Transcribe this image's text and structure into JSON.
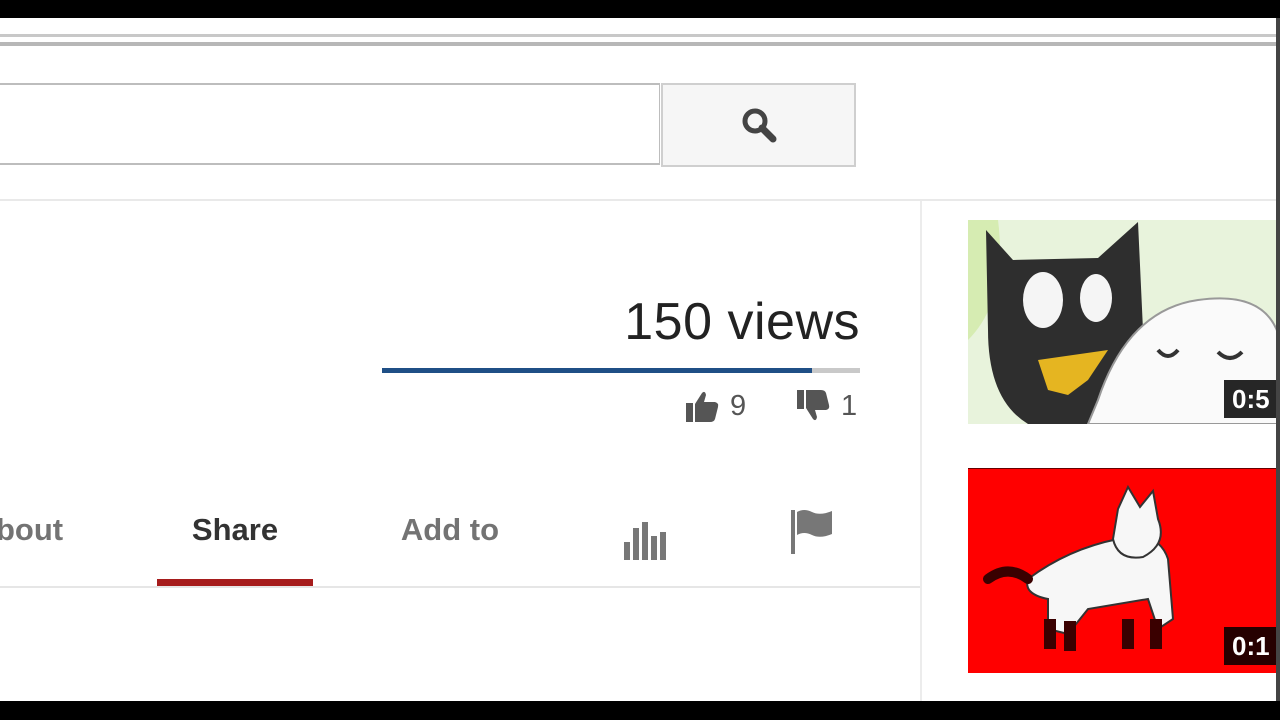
{
  "search": {
    "placeholder": "",
    "button_icon": "search-icon"
  },
  "video": {
    "views": "150 views",
    "likes": "9",
    "dislikes": "1",
    "like_ratio": 0.9
  },
  "tabs": [
    {
      "label": "bout",
      "active": false
    },
    {
      "label": "Share",
      "active": true
    },
    {
      "label": "Add to",
      "active": false
    },
    {
      "icon": "stats-icon"
    },
    {
      "icon": "flag-icon"
    }
  ],
  "related": [
    {
      "duration": "0:5"
    },
    {
      "duration": "0:1"
    }
  ],
  "colors": {
    "sentiment_like": "#1f4f86",
    "active_tab": "#a61c1c",
    "thumb2_bg": "#ff0000"
  }
}
